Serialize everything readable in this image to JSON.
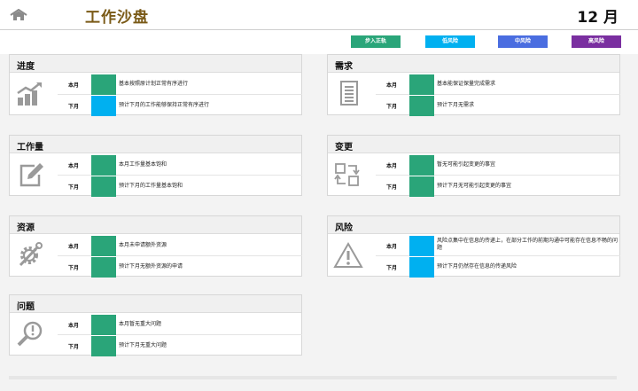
{
  "header": {
    "title": "工作沙盘",
    "month": "12 月"
  },
  "legend": [
    {
      "label": "步入正轨",
      "color": "#2aa579"
    },
    {
      "label": "低风险",
      "color": "#00b0f0"
    },
    {
      "label": "中风险",
      "color": "#4a6de0"
    },
    {
      "label": "高风险",
      "color": "#7a2fa0"
    }
  ],
  "rowLabels": {
    "current": "本月",
    "next": "下月"
  },
  "cards": [
    {
      "title": "进度",
      "icon": "bar-chart-growth-icon",
      "rows": [
        {
          "status": "步入正轨",
          "color": "#2aa579",
          "text": "基本按照原计划正常有序进行"
        },
        {
          "status": "低风险",
          "color": "#00b0f0",
          "text": "预计下月的工作能够保持正常有序进行"
        }
      ]
    },
    {
      "title": "需求",
      "icon": "document-list-icon",
      "rows": [
        {
          "status": "步入正轨",
          "color": "#2aa579",
          "text": "基本能保证保量完成需求"
        },
        {
          "status": "步入正轨",
          "color": "#2aa579",
          "text": "预计下月无需求"
        }
      ]
    },
    {
      "title": "工作量",
      "icon": "edit-pencil-icon",
      "rows": [
        {
          "status": "步入正轨",
          "color": "#2aa579",
          "text": "本月工作量基本饱和"
        },
        {
          "status": "步入正轨",
          "color": "#2aa579",
          "text": "预计下月的工作量基本饱和"
        }
      ]
    },
    {
      "title": "变更",
      "icon": "swap-boxes-icon",
      "rows": [
        {
          "status": "步入正轨",
          "color": "#2aa579",
          "text": "暂无可能引起变更的事宜"
        },
        {
          "status": "步入正轨",
          "color": "#2aa579",
          "text": "预计下月无可能引起变更的事宜"
        }
      ]
    },
    {
      "title": "资源",
      "icon": "gear-wrench-icon",
      "rows": [
        {
          "status": "步入正轨",
          "color": "#2aa579",
          "text": "本月未申请额外资源"
        },
        {
          "status": "步入正轨",
          "color": "#2aa579",
          "text": "预计下月无额外资源的申请"
        }
      ]
    },
    {
      "title": "风险",
      "icon": "warning-triangle-icon",
      "rows": [
        {
          "status": "低风险",
          "color": "#00b0f0",
          "text": "风险点集中在信息的传递上，在部分工作的前期沟通中可能存在信息不畅的问题"
        },
        {
          "status": "低风险",
          "color": "#00b0f0",
          "text": "预计下月仍然存在信息的传递风险"
        }
      ]
    },
    {
      "title": "问题",
      "icon": "magnifier-alert-icon",
      "rows": [
        {
          "status": "步入正轨",
          "color": "#2aa579",
          "text": "本月暂无重大问题"
        },
        {
          "status": "步入正轨",
          "color": "#2aa579",
          "text": "预计下月无重大问题"
        }
      ]
    }
  ]
}
